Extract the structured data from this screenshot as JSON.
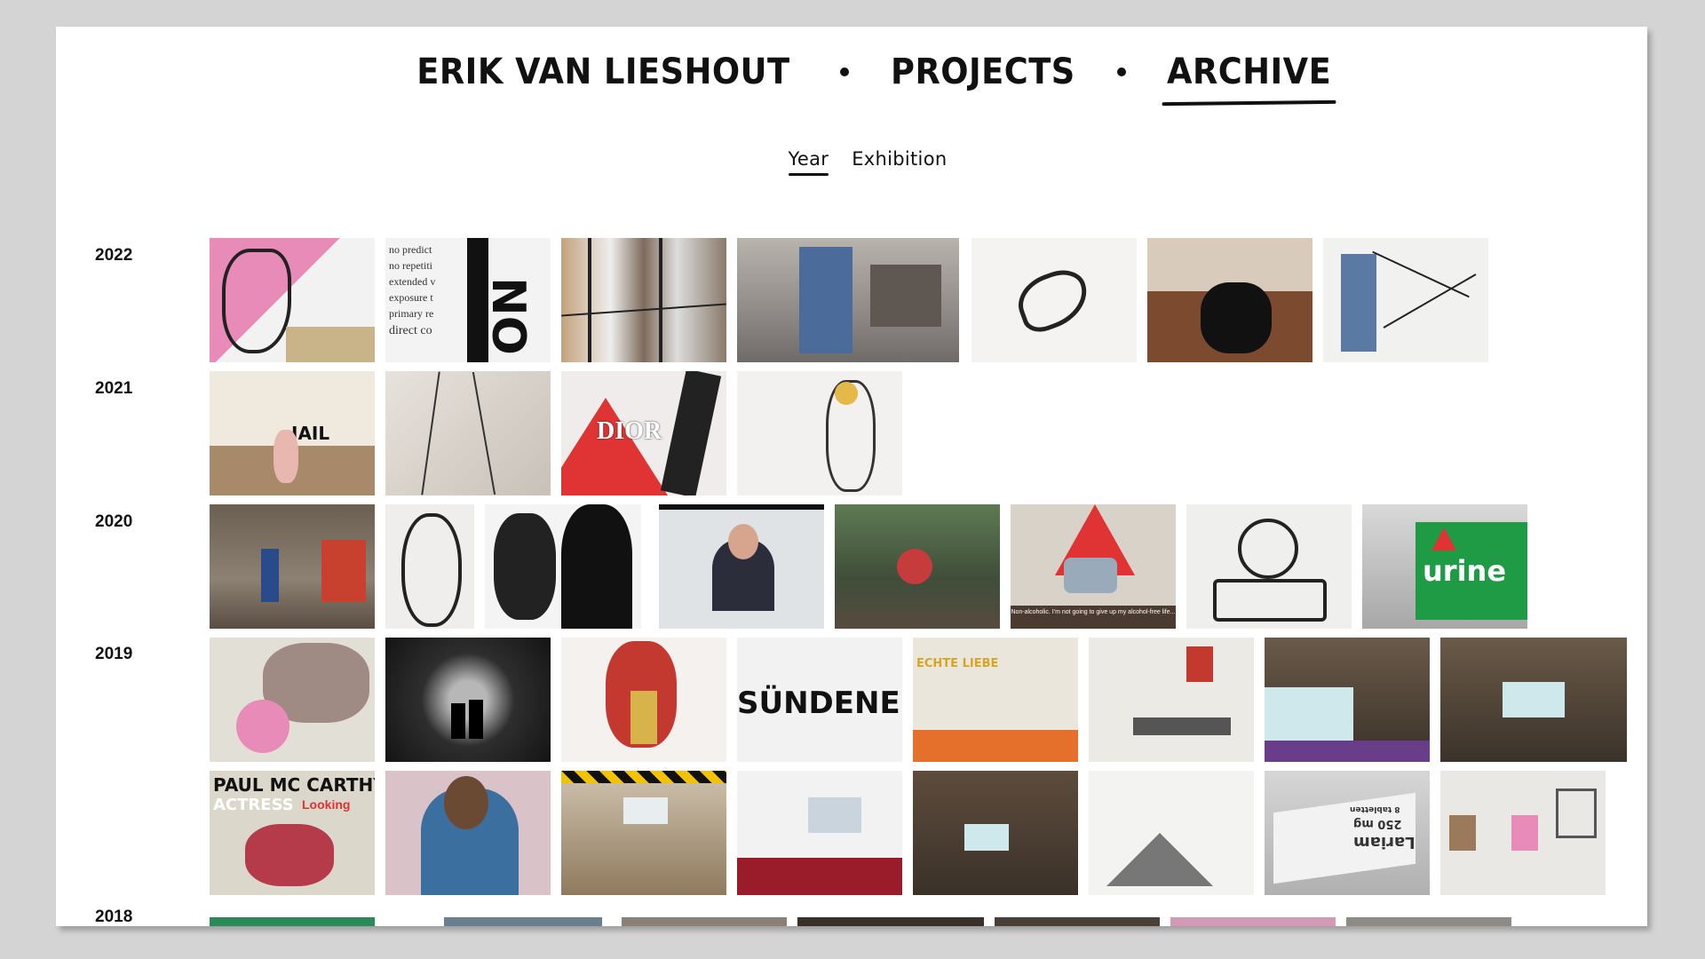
{
  "nav": {
    "items": [
      {
        "label": "ERIK VAN LIESHOUT",
        "active": false
      },
      {
        "label": "PROJECTS",
        "active": false
      },
      {
        "label": "ARCHIVE",
        "active": true
      }
    ]
  },
  "subnav": {
    "items": [
      {
        "label": "Year",
        "active": true
      },
      {
        "label": "Exhibition",
        "active": false
      }
    ]
  },
  "years": [
    {
      "label": "2022"
    },
    {
      "label": "2021"
    },
    {
      "label": "2020"
    },
    {
      "label": "2019"
    },
    {
      "label": "2018"
    }
  ],
  "thumb_texts": {
    "no_text": "NO",
    "no_lines": [
      "no predict",
      "no repetiti",
      "extended v",
      "exposure t",
      "primary re",
      "direct co"
    ],
    "jail": "JAIL",
    "dior": "DIOR",
    "urine": "urine",
    "sundenei": "SÜNDENEI",
    "mccarthy": "PAUL MC CARTHY",
    "actress": "ACTRESS",
    "looking": "Looking",
    "lariam": "Lariam",
    "lariam_dose": "250 mg",
    "lariam_tabs": "8 tabletten",
    "subtitle": "Non-alcoholic. I'm not going to give up my alcohol-free life...",
    "echte": "ECHTE LIEBE"
  },
  "colors": {
    "page_bg": "#ffffff",
    "outer_bg": "#d4d4d4",
    "text": "#111111",
    "accent_pink": "#e88bb8",
    "accent_red": "#e03333",
    "accent_green": "#1f9a45"
  }
}
